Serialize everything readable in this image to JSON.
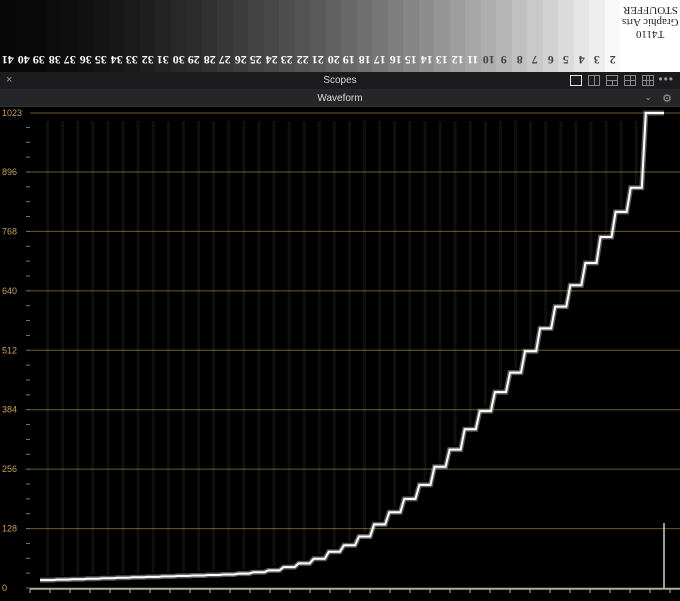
{
  "wedge": {
    "numbers": [
      "41",
      "40",
      "39",
      "38",
      "37",
      "36",
      "35",
      "34",
      "33",
      "32",
      "31",
      "30",
      "29",
      "28",
      "27",
      "26",
      "25",
      "24",
      "23",
      "22",
      "21",
      "20",
      "19",
      "18",
      "17",
      "16",
      "15",
      "14",
      "13",
      "12",
      "11",
      "10",
      "9",
      "8",
      "7",
      "6",
      "5",
      "4",
      "3",
      "2"
    ],
    "brand_lines": [
      "STOUFFER",
      "Graphic Arts",
      "T4110"
    ]
  },
  "header": {
    "close": "×",
    "title": "Scopes",
    "more": "•••"
  },
  "typebar": {
    "scope": "Waveform",
    "chevron": "⌄",
    "settings": "⚙"
  },
  "chart_data": {
    "type": "line",
    "title": "",
    "xlabel": "",
    "ylabel": "",
    "ylim": [
      0,
      1023
    ],
    "yticks": [
      0,
      128,
      256,
      384,
      512,
      640,
      768,
      896,
      1023
    ],
    "grid": true,
    "series": [
      {
        "x": [
          41,
          40,
          39,
          38,
          37,
          36,
          35,
          34,
          33,
          32,
          31,
          30,
          29,
          28,
          27,
          26,
          25,
          24,
          23,
          22,
          21,
          20,
          19,
          18,
          17,
          16,
          15,
          14,
          13,
          12,
          11,
          10,
          9,
          8,
          7,
          6,
          5,
          4,
          3,
          2
        ],
        "values": [
          17,
          18,
          19,
          20,
          21,
          22,
          23,
          24,
          25,
          26,
          27,
          28,
          29,
          31,
          34,
          38,
          45,
          53,
          63,
          78,
          92,
          111,
          137,
          163,
          192,
          222,
          261,
          298,
          342,
          381,
          422,
          464,
          510,
          559,
          606,
          652,
          700,
          756,
          810,
          862
        ]
      }
    ],
    "clip_value": 1023,
    "colors": {
      "grid": "#6b5a2c",
      "tick_label": "#c8a050",
      "trace": "#ffffff",
      "baseline": "#ffffff"
    }
  }
}
